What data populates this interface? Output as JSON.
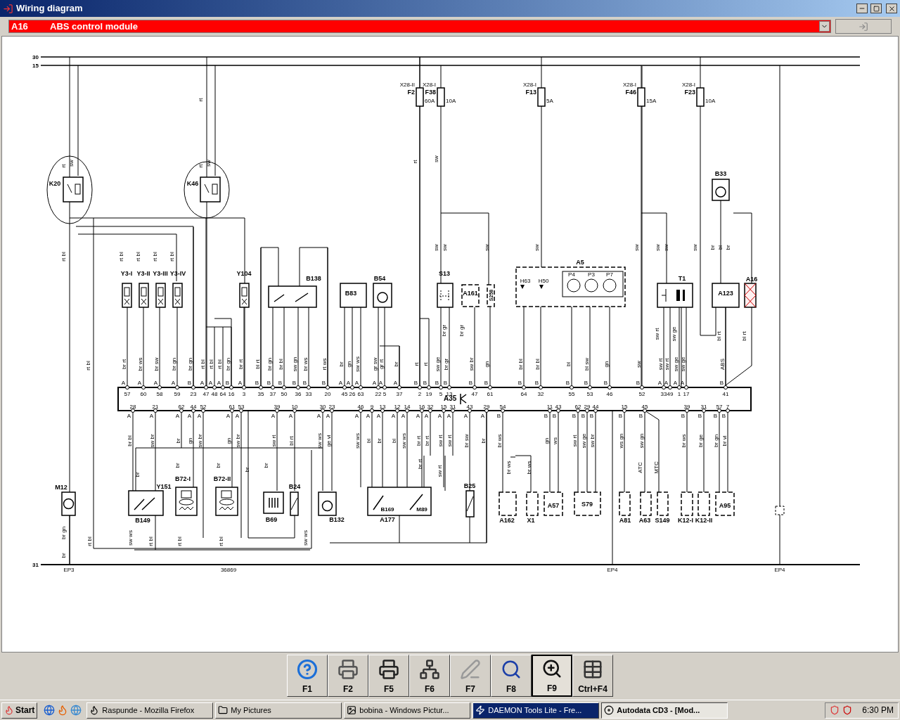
{
  "window": {
    "title": "Wiring diagram"
  },
  "selector": {
    "code": "A16",
    "name": "ABS control module"
  },
  "diagram": {
    "rails": [
      {
        "label": "30"
      },
      {
        "label": "15"
      },
      {
        "label": "31"
      }
    ],
    "fuses": [
      {
        "holder": "X28-II",
        "name": "F2",
        "rating": "60A"
      },
      {
        "holder": "X28-I",
        "name": "F38",
        "rating": "10A"
      },
      {
        "holder": "X28-I",
        "name": "F13",
        "rating": "5A"
      },
      {
        "holder": "X28-I",
        "name": "F46",
        "rating": "15A"
      },
      {
        "holder": "X28-I",
        "name": "F23",
        "rating": "10A"
      }
    ],
    "components": [
      {
        "name": "K20"
      },
      {
        "name": "K46"
      },
      {
        "name": "Y3-I"
      },
      {
        "name": "Y3-II"
      },
      {
        "name": "Y3-III"
      },
      {
        "name": "Y3-IV"
      },
      {
        "name": "Y104"
      },
      {
        "name": "B138"
      },
      {
        "name": "B83"
      },
      {
        "name": "B54"
      },
      {
        "name": "S13"
      },
      {
        "name": "A161"
      },
      {
        "name": "S258"
      },
      {
        "name": "A5"
      },
      {
        "name": "T1"
      },
      {
        "name": "A123"
      },
      {
        "name": "A16"
      },
      {
        "name": "B33"
      },
      {
        "name": "M12"
      },
      {
        "name": "B149"
      },
      {
        "name": "Y151"
      },
      {
        "name": "B72-I"
      },
      {
        "name": "B72-II"
      },
      {
        "name": "B69"
      },
      {
        "name": "B24"
      },
      {
        "name": "B132"
      },
      {
        "name": "A177"
      },
      {
        "name": "B25"
      },
      {
        "name": "A162"
      },
      {
        "name": "X1"
      },
      {
        "name": "A57"
      },
      {
        "name": "S79"
      },
      {
        "name": "A81"
      },
      {
        "name": "A63"
      },
      {
        "name": "S149"
      },
      {
        "name": "K12-I"
      },
      {
        "name": "K12-II"
      },
      {
        "name": "A95"
      }
    ],
    "sub_labels": [
      {
        "text": "H63"
      },
      {
        "text": "H50"
      },
      {
        "text": "P4"
      },
      {
        "text": "P3"
      },
      {
        "text": "P7"
      },
      {
        "text": "B169"
      },
      {
        "text": "M89"
      }
    ],
    "connector": {
      "name": "A35",
      "top_pins": [
        {
          "contact": "A",
          "pin": "57",
          "wire": "br rt"
        },
        {
          "contact": "A",
          "pin": "60",
          "wire": "br ws"
        },
        {
          "contact": "A",
          "pin": "58",
          "wire": "br sw"
        },
        {
          "contact": "A",
          "pin": "59",
          "wire": "br gn"
        },
        {
          "contact": "B",
          "pin": "23",
          "wire": "br gn"
        },
        {
          "contact": "A",
          "pin": "47",
          "wire": "rt bl"
        },
        {
          "contact": "A",
          "pin": "48",
          "wire": "rt bl"
        },
        {
          "contact": "A",
          "pin": "64",
          "wire": "rt bl"
        },
        {
          "contact": "B",
          "pin": "16",
          "wire": "br gn"
        },
        {
          "contact": "A",
          "pin": "3",
          "wire": "br rt"
        },
        {
          "contact": "B",
          "pin": "35",
          "wire": "bl rt"
        },
        {
          "contact": "B",
          "pin": "37",
          "wire": "br gn"
        },
        {
          "contact": "B",
          "pin": "50",
          "wire": "br bl"
        },
        {
          "contact": "B",
          "pin": "36",
          "wire": "sw gn"
        },
        {
          "contact": "B",
          "pin": "33",
          "wire": "br ws"
        },
        {
          "contact": "B",
          "pin": "20",
          "wire": "rt ws"
        },
        {
          "contact": "A",
          "pin": "45",
          "wire": "br"
        },
        {
          "contact": "A",
          "pin": "26",
          "wire": "gn"
        },
        {
          "contact": "A",
          "pin": "63",
          "wire": "sw ws"
        },
        {
          "contact": "A",
          "pin": "22",
          "wire": "gr sw"
        },
        {
          "contact": "A",
          "pin": "5",
          "wire": "gr rt"
        },
        {
          "contact": "A",
          "pin": "37",
          "wire": "br"
        },
        {
          "contact": "B",
          "pin": "2",
          "wire": "rt"
        },
        {
          "contact": "B",
          "pin": "19",
          "wire": "rt"
        },
        {
          "contact": "B",
          "pin": "5",
          "wire": "sw ge"
        },
        {
          "contact": "B",
          "pin": "13",
          "wire": "br gr"
        },
        {
          "contact": "B",
          "pin": "47",
          "wire": "sw br"
        },
        {
          "contact": "B",
          "pin": "61",
          "wire": "gn"
        },
        {
          "contact": "B",
          "pin": "64",
          "wire": "br bl"
        },
        {
          "contact": "B",
          "pin": "32",
          "wire": "br bl"
        },
        {
          "contact": "B",
          "pin": "55",
          "wire": "bl"
        },
        {
          "contact": "B",
          "pin": "53",
          "wire": "bl sw"
        },
        {
          "contact": "B",
          "pin": "46",
          "wire": "gn"
        },
        {
          "contact": "B",
          "pin": "52",
          "wire": "sw"
        },
        {
          "contact": "A",
          "pin": "33",
          "wire": "sw rt"
        },
        {
          "contact": "A",
          "pin": "49",
          "wire": "sw rt"
        },
        {
          "contact": "A",
          "pin": "1",
          "wire": "sw ge"
        },
        {
          "contact": "A",
          "pin": "17",
          "wire": "sw ge"
        },
        {
          "contact": "B",
          "pin": "41",
          "wire": "ABS"
        }
      ],
      "bottom_pins": [
        {
          "contact": "A",
          "pin": "28",
          "wire": "br bl"
        },
        {
          "contact": "A",
          "pin": "21",
          "wire": "sw br"
        },
        {
          "contact": "A",
          "pin": "62",
          "wire": "br"
        },
        {
          "contact": "A",
          "pin": "44",
          "wire": "gn"
        },
        {
          "contact": "A",
          "pin": "52",
          "wire": "sw br"
        },
        {
          "contact": "A",
          "pin": "61",
          "wire": "gn"
        },
        {
          "contact": "A",
          "pin": "53",
          "wire": "sw br"
        },
        {
          "contact": "A",
          "pin": "39",
          "wire": "sw rt"
        },
        {
          "contact": "A",
          "pin": "10",
          "wire": "bl rt"
        },
        {
          "contact": "A",
          "pin": "30",
          "wire": "sw ws"
        },
        {
          "contact": "A",
          "pin": "23",
          "wire": "ge vi"
        },
        {
          "contact": "A",
          "pin": "46",
          "wire": "sw ws"
        },
        {
          "contact": "A",
          "pin": "9",
          "wire": "bl"
        },
        {
          "contact": "A",
          "pin": "13",
          "wire": "br"
        },
        {
          "contact": "A",
          "pin": "12",
          "wire": "bl"
        },
        {
          "contact": "A",
          "pin": "14",
          "wire": "sw ws"
        },
        {
          "contact": "A",
          "pin": "16",
          "wire": "br rt"
        },
        {
          "contact": "A",
          "pin": "32",
          "wire": "br rt"
        },
        {
          "contact": "A",
          "pin": "15",
          "wire": "sw rt"
        },
        {
          "contact": "A",
          "pin": "31",
          "wire": "sw rt"
        },
        {
          "contact": "A",
          "pin": "43",
          "wire": "br sw"
        },
        {
          "contact": "A",
          "pin": "29",
          "wire": "br"
        },
        {
          "contact": "B",
          "pin": "54",
          "wire": "br ws"
        },
        {
          "contact": "B",
          "pin": "11",
          "wire": "gn"
        },
        {
          "contact": "B",
          "pin": "43",
          "wire": "ws"
        },
        {
          "contact": "B",
          "pin": "62",
          "wire": "sw rt"
        },
        {
          "contact": "B",
          "pin": "29",
          "wire": "sw ge"
        },
        {
          "contact": "B",
          "pin": "44",
          "wire": "sw br"
        },
        {
          "contact": "B",
          "pin": "15",
          "wire": "ws gn"
        },
        {
          "contact": "B",
          "pin": "45",
          "wire": "sw gn"
        },
        {
          "contact": "B",
          "pin": "39",
          "wire": "br ws"
        },
        {
          "contact": "B",
          "pin": "31",
          "wire": "br ge"
        },
        {
          "contact": "B",
          "pin": "57",
          "wire": "br gn"
        },
        {
          "contact": "B",
          "pin": "7",
          "wire": "br vi"
        }
      ]
    },
    "wire_labels": [
      {
        "text": "rt"
      },
      {
        "text": "sw"
      },
      {
        "text": "rt"
      },
      {
        "text": "sw"
      },
      {
        "text": "rt"
      },
      {
        "text": "rt bl"
      },
      {
        "text": "rt bl"
      },
      {
        "text": "rt bl"
      },
      {
        "text": "rt bl"
      },
      {
        "text": "rt bl"
      },
      {
        "text": "rt bl"
      },
      {
        "text": "rt"
      },
      {
        "text": "sw"
      },
      {
        "text": "sw"
      },
      {
        "text": "sw"
      },
      {
        "text": "sw"
      },
      {
        "text": "sw"
      },
      {
        "text": "sw"
      },
      {
        "text": "sw"
      },
      {
        "text": "sw"
      },
      {
        "text": "sw"
      },
      {
        "text": "br"
      },
      {
        "text": "bl"
      },
      {
        "text": "br"
      },
      {
        "text": "br gr"
      },
      {
        "text": "br gr"
      },
      {
        "text": "sw rt"
      },
      {
        "text": "sw ge"
      },
      {
        "text": "bl rt"
      },
      {
        "text": "bl rt"
      },
      {
        "text": "br"
      },
      {
        "text": "br"
      },
      {
        "text": "br"
      },
      {
        "text": "br"
      },
      {
        "text": "br"
      },
      {
        "text": "br gn"
      },
      {
        "text": "br"
      },
      {
        "text": "rt bl"
      },
      {
        "text": "sw ws"
      },
      {
        "text": "rt bl"
      },
      {
        "text": "rt bl"
      },
      {
        "text": "rt bl"
      },
      {
        "text": "sw ws"
      },
      {
        "text": "br rt"
      },
      {
        "text": "sw rt"
      },
      {
        "text": "br ws"
      },
      {
        "text": "br ws"
      },
      {
        "text": "ATC"
      },
      {
        "text": "MTC"
      }
    ],
    "grounds": [
      {
        "label": "EP3"
      },
      {
        "label": "36869"
      },
      {
        "label": "EP4"
      },
      {
        "label": "EP4"
      }
    ]
  },
  "toolbar": [
    {
      "key": "F1",
      "selected": false
    },
    {
      "key": "F2",
      "selected": false
    },
    {
      "key": "F5",
      "selected": false
    },
    {
      "key": "F6",
      "selected": false
    },
    {
      "key": "F7",
      "selected": false
    },
    {
      "key": "F8",
      "selected": false
    },
    {
      "key": "F9",
      "selected": true
    },
    {
      "key": "Ctrl+F4",
      "selected": false
    }
  ],
  "taskbar": {
    "start": "Start",
    "tasks": [
      {
        "label": "Raspunde - Mozilla Firefox",
        "selected": false,
        "flashing": false
      },
      {
        "label": "My Pictures",
        "selected": false,
        "flashing": false
      },
      {
        "label": "bobina - Windows Pictur...",
        "selected": false,
        "flashing": false
      },
      {
        "label": "DAEMON Tools Lite - Fre...",
        "selected": false,
        "flashing": true
      },
      {
        "label": "Autodata CD3 - [Mod...",
        "selected": true,
        "flashing": false
      }
    ],
    "clock": "6:30 PM"
  }
}
